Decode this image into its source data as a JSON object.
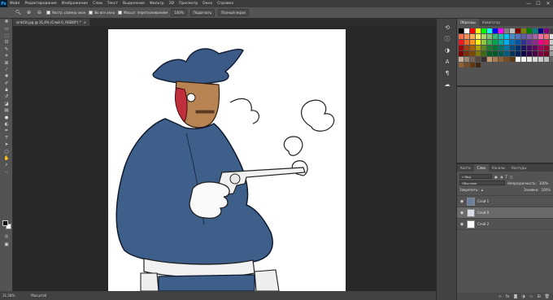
{
  "menubar": {
    "logo": "Ps",
    "items": [
      "Файл",
      "Редактирование",
      "Изображение",
      "Слои",
      "Текст",
      "Выделение",
      "Фильтр",
      "3D",
      "Просмотр",
      "Окно",
      "Справка"
    ],
    "minimize": "—",
    "maximize": "☐",
    "close": "✕"
  },
  "options": {
    "fit_label": "Настр. размер окон",
    "all_windows_label": "Во все окна",
    "scrubby_label": "Масшт. перетаскиванием",
    "zoom_value": "100%",
    "fit_screen": "Подогнать",
    "fill_screen": "Полный экран"
  },
  "document": {
    "tab_title": "sintd1t.jpg @ 31,6% (Слой 0, RGB/8*) *",
    "tab_close": "×"
  },
  "status": {
    "zoom": "31,58%",
    "info": "Масштаб"
  },
  "colors": {
    "coat": "#3e5f8a",
    "hat": "#3c5a86",
    "skin": "#b88352",
    "wound": "#c0303c",
    "ps_blue": "#31a8ff"
  },
  "swatches_panel": {
    "tabs": [
      "Образцы",
      "Навигатор"
    ],
    "colors": [
      "#000000",
      "#ffffff",
      "#ff0000",
      "#ffff00",
      "#00ff00",
      "#00ffff",
      "#0000ff",
      "#ff00ff",
      "#808080",
      "#c0c0c0",
      "#800000",
      "#808000",
      "#008000",
      "#008080",
      "#000080",
      "#800080",
      "#404040",
      "#f26c4f",
      "#f68e55",
      "#fbaf5c",
      "#fff467",
      "#acd372",
      "#7cc576",
      "#3bb878",
      "#1abbb4",
      "#00bff3",
      "#438ccb",
      "#5574b9",
      "#605ca8",
      "#855fa8",
      "#a763a8",
      "#f06ea9",
      "#f26d7d",
      "#e6e6e6",
      "#ed1c24",
      "#f26522",
      "#f7941d",
      "#fff200",
      "#8dc73f",
      "#39b54a",
      "#00a651",
      "#00a99d",
      "#00aeef",
      "#0072bc",
      "#0054a6",
      "#2e3192",
      "#662d91",
      "#92278f",
      "#ec008c",
      "#ed145b",
      "#cccccc",
      "#9e0b0f",
      "#a0410d",
      "#a36209",
      "#aba000",
      "#598527",
      "#1a7b30",
      "#007236",
      "#00746b",
      "#0076a3",
      "#004b80",
      "#003471",
      "#1b1464",
      "#440e62",
      "#630460",
      "#9e005d",
      "#9e0039",
      "#b3b3b3",
      "#790000",
      "#7b2e00",
      "#7d4900",
      "#827b00",
      "#406618",
      "#005e20",
      "#005826",
      "#005952",
      "#005b7f",
      "#003663",
      "#002157",
      "#0d004c",
      "#32004b",
      "#4b0049",
      "#7b0046",
      "#7a0026",
      "#999999",
      "#c7b299",
      "#998675",
      "#736357",
      "#534741",
      "#37302d",
      "#c69c6d",
      "#a67c52",
      "#8c6239",
      "#754c24",
      "#603913",
      "#ffffff",
      "#f2f2f2",
      "#e6e6e6",
      "#d9d9d9",
      "#cccccc",
      "#bfbfbf",
      "#666666",
      "#8c6239",
      "#754c24",
      "#603913",
      "#3f2a14"
    ]
  },
  "layers_panel": {
    "tabs": [
      "Кисти",
      "Слои",
      "Каналы",
      "Контуры"
    ],
    "kind_label": "Вид",
    "blend_mode": "Обычные",
    "opacity_label": "Непрозрачность:",
    "opacity_value": "100%",
    "lock_label": "Закрепить:",
    "fill_label": "Заливка:",
    "fill_value": "100%",
    "layers": [
      {
        "name": "Слой 1",
        "selected": false
      },
      {
        "name": "Слой 0",
        "selected": true
      },
      {
        "name": "Слой 2",
        "selected": false
      }
    ]
  },
  "tools": [
    "move-tool",
    "artboard-tool",
    "marquee-tool",
    "lasso-tool",
    "quick-select-tool",
    "crop-tool",
    "frame-tool",
    "eyedropper-tool",
    "healing-tool",
    "brush-tool",
    "stamp-tool",
    "history-brush-tool",
    "eraser-tool",
    "gradient-tool",
    "blur-tool",
    "dodge-tool",
    "pen-tool",
    "type-tool",
    "path-select-tool",
    "shape-tool",
    "hand-tool",
    "zoom-tool",
    "more-tools"
  ]
}
